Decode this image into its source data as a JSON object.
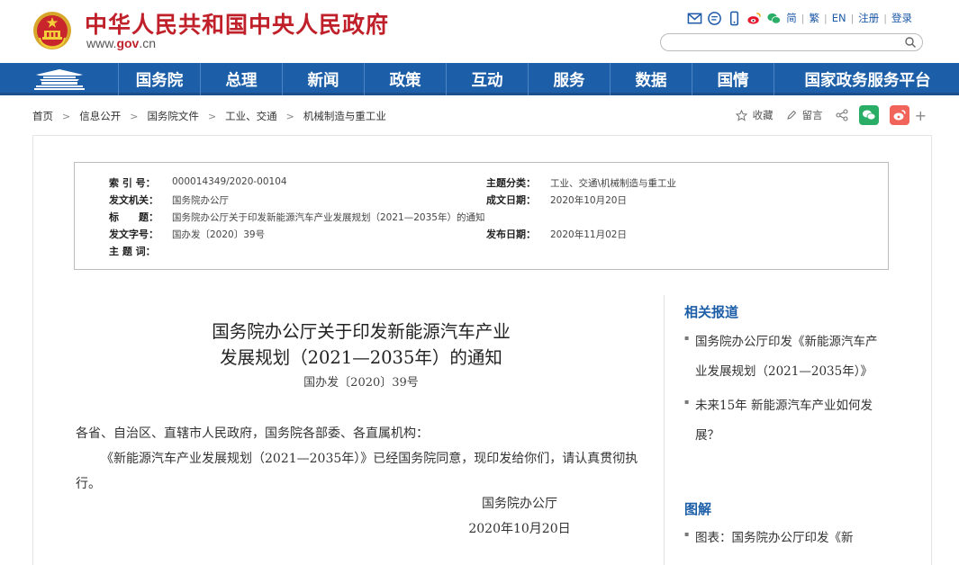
{
  "header": {
    "site_name": "中华人民共和国中央人民政府",
    "site_url_prefix": "www.",
    "site_url_domain": "gov",
    "site_url_suffix": ".cn",
    "lang_links": [
      "简",
      "繁",
      "EN",
      "注册",
      "登录"
    ],
    "search_placeholder": "",
    "icons": [
      "mail-icon",
      "message-icon",
      "mobile-icon",
      "weibo-icon",
      "wechat-icon"
    ]
  },
  "nav": {
    "items": [
      "国务院",
      "总理",
      "新闻",
      "政策",
      "互动",
      "服务",
      "数据",
      "国情",
      "国家政务服务平台"
    ]
  },
  "breadcrumb": [
    "首页",
    "信息公开",
    "国务院文件",
    "工业、交通",
    "机械制造与重工业"
  ],
  "share": {
    "favorite_label": "收藏",
    "comment_label": "留言",
    "more_label": "+"
  },
  "info": {
    "index_key": "索 引 号：",
    "index_val": "000014349/2020-00104",
    "category_key": "主题分类：",
    "category_val": "工业、交通\\机械制造与重工业",
    "issuer_key": "发文机关：",
    "issuer_val": "国务院办公厅",
    "written_key": "成文日期：",
    "written_val": "2020年10月20日",
    "title_key": "标　　题：",
    "title_val": "国务院办公厅关于印发新能源汽车产业发展规划（2021—2035年）的通知",
    "docno_key": "发文字号：",
    "docno_val": "国办发〔2020〕39号",
    "published_key": "发布日期：",
    "published_val": "2020年11月02日",
    "subject_key": "主 题 词："
  },
  "article": {
    "title_line1": "国务院办公厅关于印发新能源汽车产业",
    "title_line2": "发展规划（2021—2035年）的通知",
    "doc_number": "国办发〔2020〕39号",
    "para1": "各省、自治区、直辖市人民政府，国务院各部委、各直属机构：",
    "para2": "《新能源汽车产业发展规划（2021—2035年）》已经国务院同意，现印发给你们，请认真贯彻执行。",
    "sign_org": "国务院办公厅",
    "sign_date": "2020年10月20日"
  },
  "sidebar": {
    "related_title": "相关报道",
    "related_items": [
      "国务院办公厅印发《新能源汽车产业发展规划（2021—2035年）》",
      "未来15年 新能源汽车产业如何发展？"
    ],
    "graphic_title": "图解",
    "graphic_items": [
      "图表：国务院办公厅印发《新"
    ]
  },
  "colors": {
    "brand_red": "#c0202a",
    "nav_blue": "#1c5ea7",
    "link_blue": "#1e5aa8"
  }
}
